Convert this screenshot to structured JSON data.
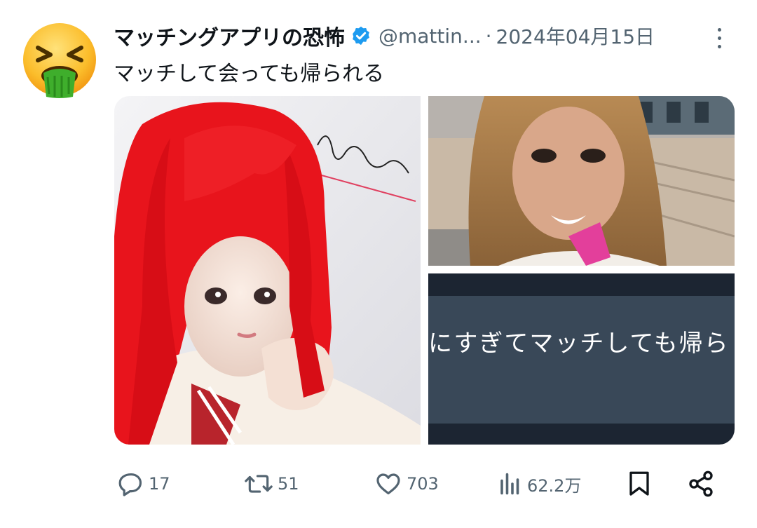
{
  "tweet": {
    "avatar_icon": "vomiting-face-emoji",
    "display_name": "マッチングアプリの恐怖",
    "verified": true,
    "handle": "@mattin...",
    "separator": "·",
    "date": "2024年04月15日",
    "text": "マッチして会っても帰られる",
    "media": {
      "image3_caption": "にすぎてマッチしても帰ら"
    },
    "actions": {
      "replies": "17",
      "retweets": "51",
      "likes": "703",
      "views": "62.2万"
    }
  },
  "colors": {
    "accent": "#1d9bf0",
    "text_primary": "#0f1419",
    "text_secondary": "#536471",
    "red_hair": "#e8141c"
  }
}
